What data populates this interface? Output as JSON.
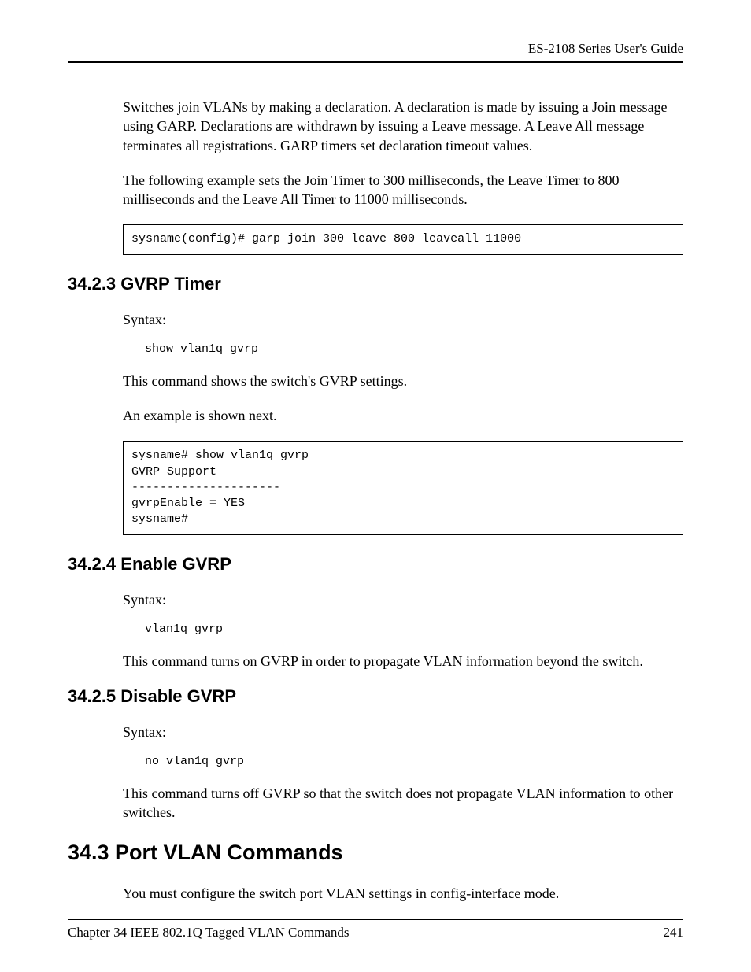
{
  "header": {
    "guide_title": "ES-2108 Series User's Guide"
  },
  "intro": {
    "para1": "Switches join VLANs by making a declaration. A declaration is made by issuing a Join message using GARP. Declarations are withdrawn by issuing a Leave message. A Leave All message terminates all registrations. GARP timers set declaration timeout values.",
    "para2": "The following example sets the Join Timer to 300 milliseconds, the Leave Timer to 800 milliseconds and the Leave All Timer to 11000 milliseconds.",
    "code": "sysname(config)# garp join 300 leave 800 leaveall 11000"
  },
  "sec_3423": {
    "heading": "34.2.3  GVRP Timer",
    "syntax_label": "Syntax:",
    "syntax_cmd": "show vlan1q gvrp",
    "desc": "This command shows the switch's GVRP settings.",
    "example_label": "An example is shown next.",
    "code": "sysname# show vlan1q gvrp\nGVRP Support\n---------------------\ngvrpEnable = YES\nsysname#"
  },
  "sec_3424": {
    "heading": "34.2.4  Enable GVRP",
    "syntax_label": "Syntax:",
    "syntax_cmd": "vlan1q gvrp",
    "desc": "This command turns on GVRP in order to propagate VLAN information beyond the switch."
  },
  "sec_3425": {
    "heading": "34.2.5  Disable GVRP",
    "syntax_label": "Syntax:",
    "syntax_cmd": "no vlan1q gvrp",
    "desc": "This command turns off GVRP so that the switch does not propagate VLAN information to other switches."
  },
  "sec_343": {
    "heading": "34.3  Port VLAN Commands",
    "desc": "You must configure the switch port VLAN settings in config-interface mode."
  },
  "footer": {
    "chapter": "Chapter 34 IEEE 802.1Q Tagged VLAN Commands",
    "page": "241"
  }
}
